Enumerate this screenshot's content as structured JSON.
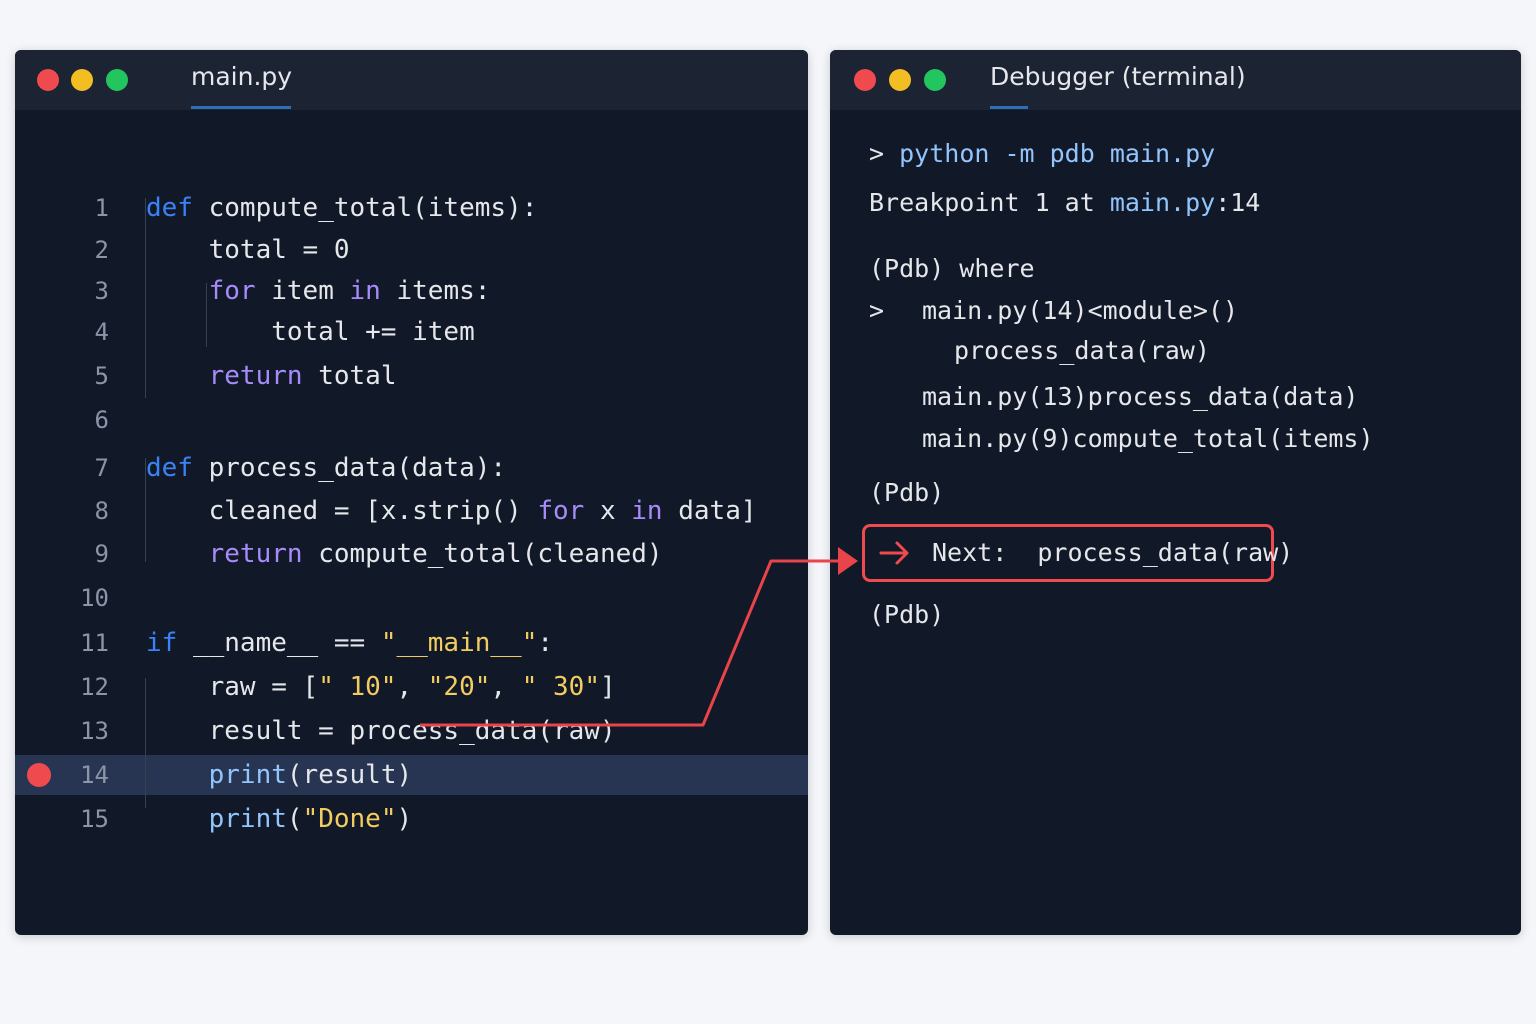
{
  "editor": {
    "tab": "main.py",
    "breakpoint_line": "14",
    "lines": [
      {
        "n": "1",
        "t": [
          {
            "c": "kw",
            "s": "def"
          },
          {
            "s": " compute_total(items):"
          }
        ]
      },
      {
        "n": "2",
        "t": [
          {
            "s": "    total = 0"
          }
        ]
      },
      {
        "n": "3",
        "t": [
          {
            "s": "    "
          },
          {
            "c": "kw2",
            "s": "for"
          },
          {
            "s": " item "
          },
          {
            "c": "kw2",
            "s": "in"
          },
          {
            "s": " items:"
          }
        ]
      },
      {
        "n": "4",
        "t": [
          {
            "s": "        total += item"
          }
        ]
      },
      {
        "n": "5",
        "t": [
          {
            "s": "    "
          },
          {
            "c": "kw2",
            "s": "return"
          },
          {
            "s": " total"
          }
        ]
      },
      {
        "n": "6",
        "t": []
      },
      {
        "n": "7",
        "t": [
          {
            "c": "kw",
            "s": "def"
          },
          {
            "s": " process_data(data):"
          }
        ]
      },
      {
        "n": "8",
        "t": [
          {
            "s": "    cleaned = [x.strip() "
          },
          {
            "c": "kw2",
            "s": "for"
          },
          {
            "s": " x "
          },
          {
            "c": "kw2",
            "s": "in"
          },
          {
            "s": " data]"
          }
        ]
      },
      {
        "n": "9",
        "t": [
          {
            "s": "    "
          },
          {
            "c": "kw2",
            "s": "return"
          },
          {
            "s": " compute_total(cleaned)"
          }
        ]
      },
      {
        "n": "10",
        "t": []
      },
      {
        "n": "11",
        "t": [
          {
            "c": "kw",
            "s": "if"
          },
          {
            "s": " __name__ == "
          },
          {
            "c": "str",
            "s": "\"__main__\""
          },
          {
            "s": ":"
          }
        ]
      },
      {
        "n": "12",
        "t": [
          {
            "s": "    raw = ["
          },
          {
            "c": "str",
            "s": "\" 10\""
          },
          {
            "s": ", "
          },
          {
            "c": "str",
            "s": "\"20\""
          },
          {
            "s": ", "
          },
          {
            "c": "str",
            "s": "\" 30\""
          },
          {
            "s": "]"
          }
        ]
      },
      {
        "n": "13",
        "t": [
          {
            "s": "    result = process_data(raw)"
          }
        ]
      },
      {
        "n": "14",
        "t": [
          {
            "s": "    "
          },
          {
            "c": "fn",
            "s": "print"
          },
          {
            "s": "(result)"
          }
        ]
      },
      {
        "n": "15",
        "t": [
          {
            "s": "    "
          },
          {
            "c": "fn",
            "s": "print"
          },
          {
            "s": "("
          },
          {
            "c": "str",
            "s": "\"Done\""
          },
          {
            "s": ")"
          }
        ]
      }
    ]
  },
  "debugger": {
    "tab": "Debugger (terminal)",
    "cmd_prompt": "> ",
    "cmd": "python -m pdb main.py",
    "breakpoint_prefix": "Breakpoint 1 at ",
    "breakpoint_file": "main.py",
    "breakpoint_line": ":14",
    "pdb_where": "(Pdb) where",
    "stack_marker": ">",
    "stack_1": "main.py(14)<module>()",
    "stack_1_src": "process_data(raw)",
    "stack_2": "main.py(13)process_data(data)",
    "stack_3": "main.py(9)compute_total(items)",
    "pdb_prompt_1": "(Pdb)",
    "next_label": "Next:  process_data(raw)",
    "pdb_prompt_2": "(Pdb)"
  },
  "colors": {
    "accent_red": "#ef4b4f",
    "keyword_blue": "#3b82f6",
    "keyword_purple": "#a78bfa",
    "string_yellow": "#f2cc60",
    "background": "#111827"
  }
}
